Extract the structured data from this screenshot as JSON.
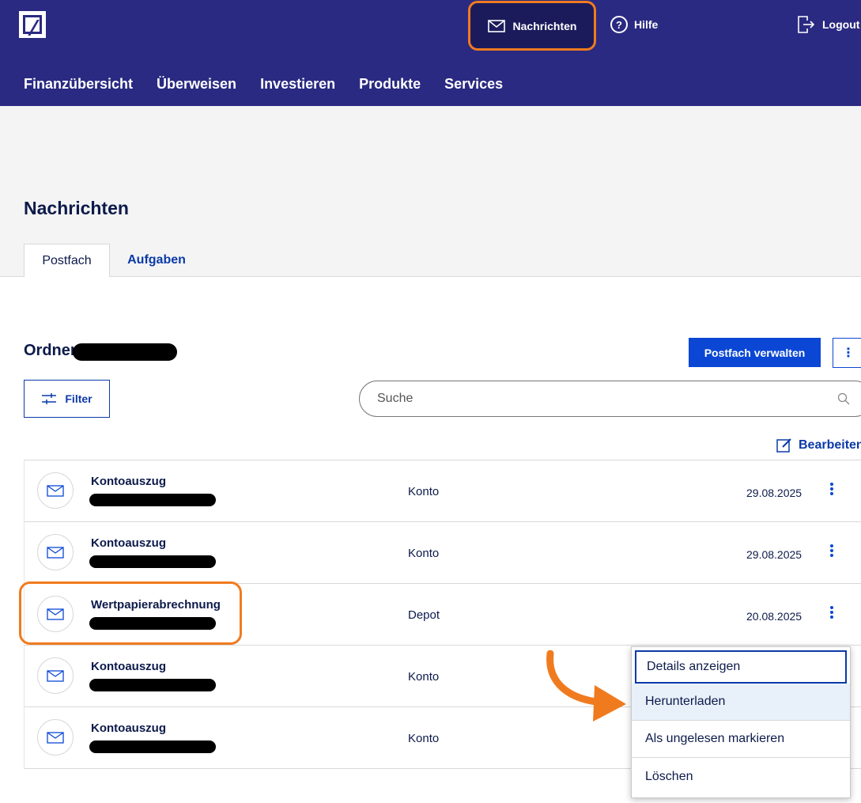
{
  "header": {
    "nav_messages": "Nachrichten",
    "nav_help": "Hilfe",
    "nav_help_icon": "?",
    "nav_logout": "Logout",
    "main_nav": [
      "Finanzübersicht",
      "Überweisen",
      "Investieren",
      "Produkte",
      "Services"
    ]
  },
  "page": {
    "title": "Nachrichten",
    "tabs": [
      {
        "label": "Postfach",
        "active": true
      },
      {
        "label": "Aufgaben",
        "active": false
      }
    ]
  },
  "content": {
    "folder_label": "Ordner",
    "manage_button": "Postfach verwalten",
    "more_button": "⋮",
    "filter_button": "Filter",
    "search_placeholder": "Suche",
    "edit_link": "Bearbeiten"
  },
  "messages": [
    {
      "title": "Kontoauszug",
      "category": "Konto",
      "date": "29.08.2025"
    },
    {
      "title": "Kontoauszug",
      "category": "Konto",
      "date": "29.08.2025"
    },
    {
      "title": "Wertpapierabrechnung",
      "category": "Depot",
      "date": "20.08.2025"
    },
    {
      "title": "Kontoauszug",
      "category": "Konto",
      "date": ""
    },
    {
      "title": "Kontoauszug",
      "category": "Konto",
      "date": ""
    }
  ],
  "context_menu": {
    "items": [
      "Details anzeigen",
      "Herunterladen",
      "Als ungelesen markieren",
      "Löschen"
    ]
  },
  "colors": {
    "brand": "#2a2a82",
    "accent": "#0b47d4",
    "highlight": "#f07b1e"
  },
  "icons": {
    "envelope": "envelope-icon",
    "help": "help-icon",
    "logout": "logout-icon",
    "filter": "filter-icon",
    "search": "search-icon",
    "edit": "edit-icon",
    "kebab": "kebab-icon"
  }
}
